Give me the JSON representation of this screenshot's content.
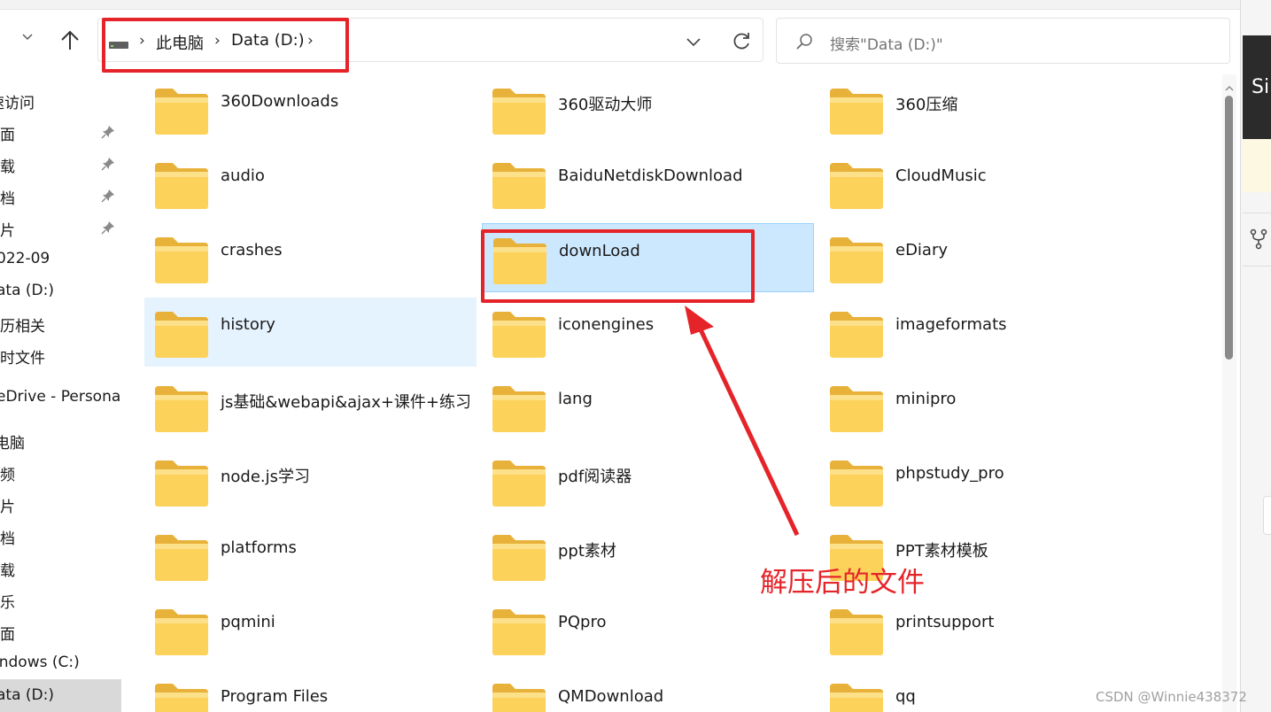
{
  "address": {
    "crumbs": [
      "此电脑",
      "Data (D:)"
    ]
  },
  "search": {
    "placeholder": "搜索\"Data (D:)\""
  },
  "sidebar": {
    "items": [
      {
        "label": "速访问",
        "pinned": false,
        "selected": false
      },
      {
        "label": "面",
        "pinned": true,
        "selected": false
      },
      {
        "label": "载",
        "pinned": true,
        "selected": false
      },
      {
        "label": "档",
        "pinned": true,
        "selected": false
      },
      {
        "label": "片",
        "pinned": true,
        "selected": false
      },
      {
        "label": "022-09",
        "pinned": false,
        "selected": false
      },
      {
        "label": "ata (D:)",
        "pinned": false,
        "selected": false
      },
      {
        "label": "历相关",
        "pinned": false,
        "selected": false
      },
      {
        "label": "时文件",
        "pinned": false,
        "selected": false
      },
      {
        "label": "eDrive - Persona",
        "pinned": false,
        "selected": false
      },
      {
        "label": "电脑",
        "pinned": false,
        "selected": false
      },
      {
        "label": "频",
        "pinned": false,
        "selected": false
      },
      {
        "label": "片",
        "pinned": false,
        "selected": false
      },
      {
        "label": "档",
        "pinned": false,
        "selected": false
      },
      {
        "label": "载",
        "pinned": false,
        "selected": false
      },
      {
        "label": "乐",
        "pinned": false,
        "selected": false
      },
      {
        "label": "面",
        "pinned": false,
        "selected": false
      },
      {
        "label": "indows (C:)",
        "pinned": false,
        "selected": false
      },
      {
        "label": "ata (D:)",
        "pinned": false,
        "selected": true
      }
    ]
  },
  "folders": [
    {
      "name": "360Downloads",
      "state": ""
    },
    {
      "name": "360驱动大师",
      "state": ""
    },
    {
      "name": "360压缩",
      "state": ""
    },
    {
      "name": "audio",
      "state": ""
    },
    {
      "name": "BaiduNetdiskDownload",
      "state": ""
    },
    {
      "name": "CloudMusic",
      "state": ""
    },
    {
      "name": "crashes",
      "state": ""
    },
    {
      "name": "downLoad",
      "state": "selected"
    },
    {
      "name": "eDiary",
      "state": ""
    },
    {
      "name": "history",
      "state": "hover"
    },
    {
      "name": "iconengines",
      "state": ""
    },
    {
      "name": "imageformats",
      "state": ""
    },
    {
      "name": "js基础&webapi&ajax+课件+练习",
      "state": ""
    },
    {
      "name": "lang",
      "state": ""
    },
    {
      "name": "minipro",
      "state": ""
    },
    {
      "name": "node.js学习",
      "state": ""
    },
    {
      "name": "pdf阅读器",
      "state": ""
    },
    {
      "name": "phpstudy_pro",
      "state": ""
    },
    {
      "name": "platforms",
      "state": ""
    },
    {
      "name": "ppt素材",
      "state": ""
    },
    {
      "name": "PPT素材模板",
      "state": ""
    },
    {
      "name": "pqmini",
      "state": ""
    },
    {
      "name": "PQpro",
      "state": ""
    },
    {
      "name": "printsupport",
      "state": ""
    },
    {
      "name": "Program Files",
      "state": ""
    },
    {
      "name": "QMDownload",
      "state": ""
    },
    {
      "name": "qq",
      "state": ""
    }
  ],
  "annotation": {
    "text": "解压后的文件",
    "color": "#e5242a"
  },
  "right_window": {
    "title_fragment": "Si"
  },
  "watermark": "CSDN @Winnie438372",
  "colors": {
    "selected_bg": "#cce8ff",
    "hover_bg": "#e5f3ff",
    "folder_yellow": "#fcd25a"
  }
}
